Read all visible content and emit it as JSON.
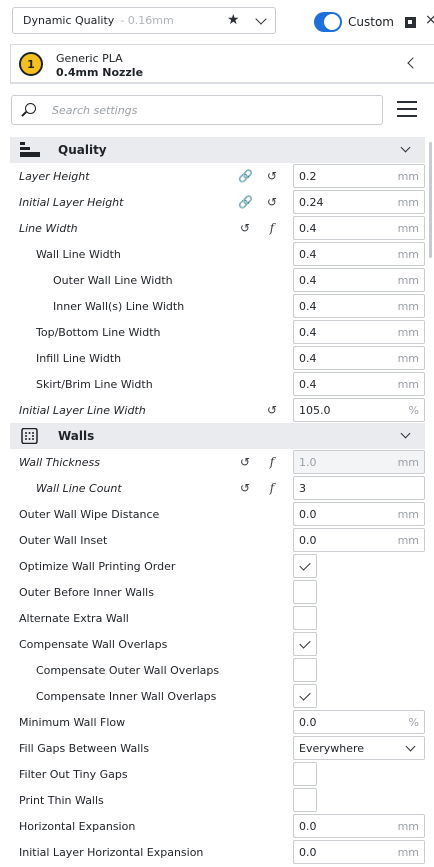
{
  "header": {
    "profile_name": "Dynamic Quality",
    "profile_layer": "- 0.16mm",
    "custom_label": "Custom",
    "toggle_on": true
  },
  "material": {
    "extruder_number": "1",
    "name": "Generic PLA",
    "nozzle": "0.4mm Nozzle"
  },
  "search": {
    "placeholder": "Search settings"
  },
  "categories": {
    "quality": "Quality",
    "walls": "Walls"
  },
  "quality_rows": [
    {
      "label": "Layer Height",
      "value": "0.2",
      "unit": "mm"
    },
    {
      "label": "Initial Layer Height",
      "value": "0.24",
      "unit": "mm"
    },
    {
      "label": "Line Width",
      "value": "0.4",
      "unit": "mm"
    },
    {
      "label": "Wall Line Width",
      "value": "0.4",
      "unit": "mm"
    },
    {
      "label": "Outer Wall Line Width",
      "value": "0.4",
      "unit": "mm"
    },
    {
      "label": "Inner Wall(s) Line Width",
      "value": "0.4",
      "unit": "mm"
    },
    {
      "label": "Top/Bottom Line Width",
      "value": "0.4",
      "unit": "mm"
    },
    {
      "label": "Infill Line Width",
      "value": "0.4",
      "unit": "mm"
    },
    {
      "label": "Skirt/Brim Line Width",
      "value": "0.4",
      "unit": "mm"
    },
    {
      "label": "Initial Layer Line Width",
      "value": "105.0",
      "unit": "%"
    }
  ],
  "walls_rows": [
    {
      "label": "Wall Thickness",
      "value": "1.0",
      "unit": "mm"
    },
    {
      "label": "Wall Line Count",
      "value": "3",
      "unit": ""
    },
    {
      "label": "Outer Wall Wipe Distance",
      "value": "0.0",
      "unit": "mm"
    },
    {
      "label": "Outer Wall Inset",
      "value": "0.0",
      "unit": "mm"
    },
    {
      "label": "Optimize Wall Printing Order",
      "checked": true
    },
    {
      "label": "Outer Before Inner Walls",
      "checked": false
    },
    {
      "label": "Alternate Extra Wall",
      "checked": false
    },
    {
      "label": "Compensate Wall Overlaps",
      "checked": true
    },
    {
      "label": "Compensate Outer Wall Overlaps",
      "checked": false
    },
    {
      "label": "Compensate Inner Wall Overlaps",
      "checked": true
    },
    {
      "label": "Minimum Wall Flow",
      "value": "0.0",
      "unit": "%"
    },
    {
      "label": "Fill Gaps Between Walls",
      "value": "Everywhere"
    },
    {
      "label": "Filter Out Tiny Gaps",
      "checked": false
    },
    {
      "label": "Print Thin Walls",
      "checked": false
    },
    {
      "label": "Horizontal Expansion",
      "value": "0.0",
      "unit": "mm"
    },
    {
      "label": "Initial Layer Horizontal Expansion",
      "value": "0.0",
      "unit": "mm"
    }
  ],
  "icons": {
    "link": "link-icon",
    "reset": "reset-icon",
    "function": "function-icon"
  },
  "colors": {
    "accent": "#1e6fd9",
    "extruder_badge": "#f3c020",
    "category_bg": "#e9ebef"
  }
}
